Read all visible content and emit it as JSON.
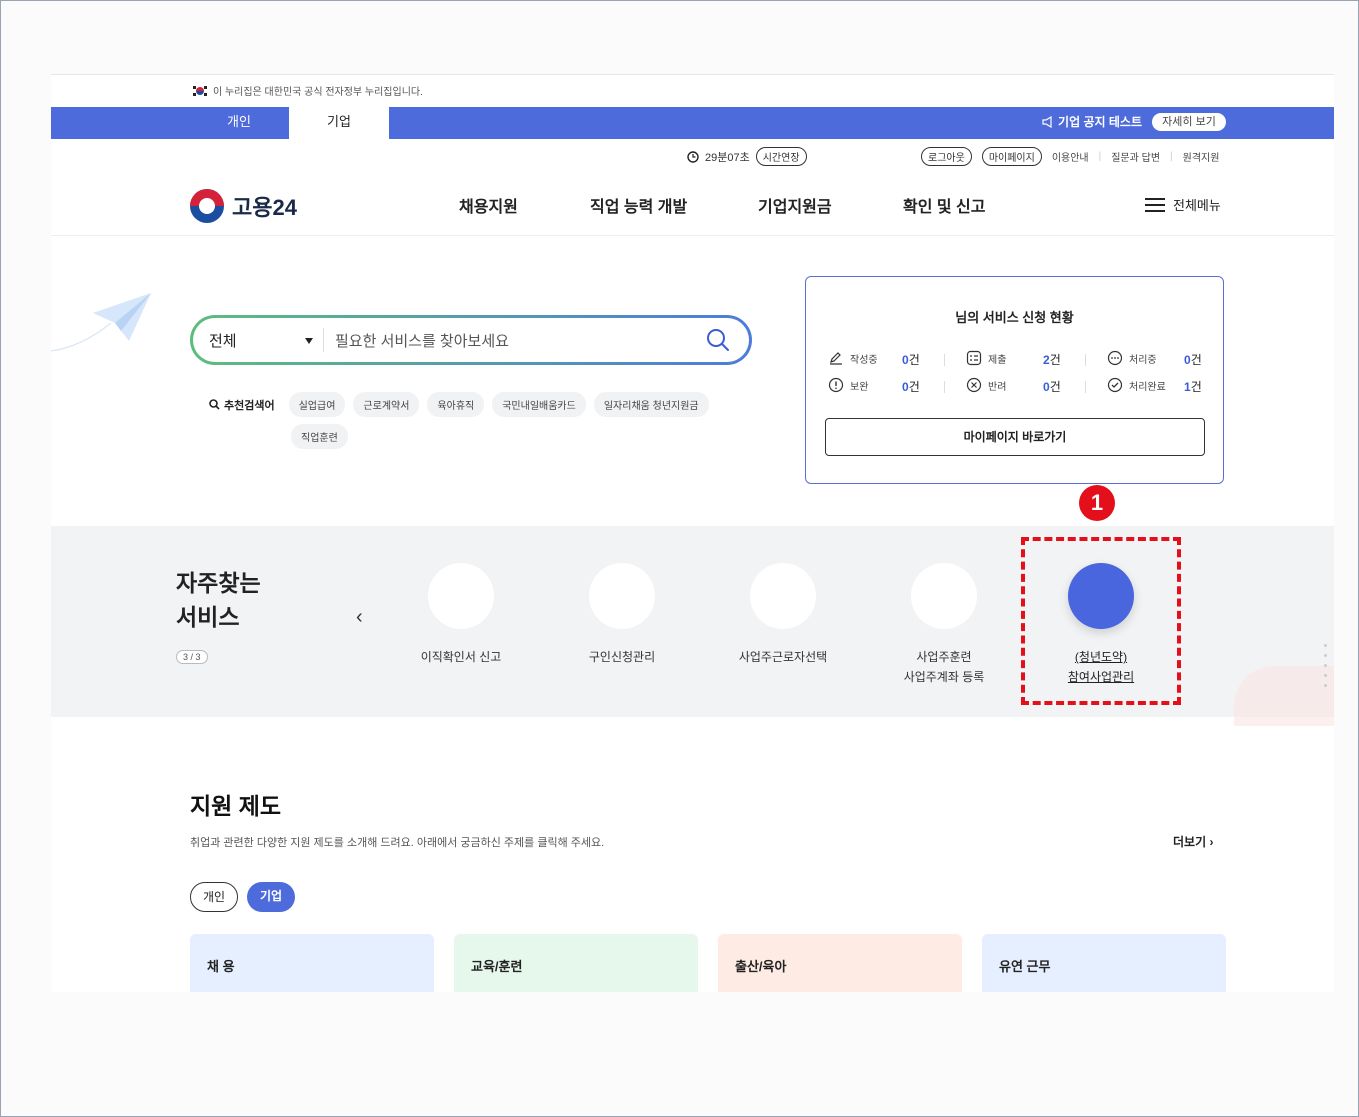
{
  "gov_banner": "이 누리집은 대한민국 공식 전자정부 누리집입니다.",
  "tabs": {
    "personal": "개인",
    "company": "기업"
  },
  "notice": {
    "text": "기업 공지 테스트",
    "button": "자세히 보기"
  },
  "session": {
    "timer": "29분07초",
    "extend": "시간연장"
  },
  "utility": {
    "logout": "로그아웃",
    "mypage": "마이페이지",
    "guide": "이용안내",
    "qa": "질문과 답변",
    "remote": "원격지원"
  },
  "logo": "고용24",
  "nav": [
    "채용지원",
    "직업 능력 개발",
    "기업지원금",
    "확인 및 신고"
  ],
  "all_menu": "전체메뉴",
  "search": {
    "category": "전체",
    "placeholder": "필요한 서비스를 찾아보세요",
    "rec_label": "추천검색어",
    "keywords": [
      "실업급여",
      "근로계약서",
      "육아휴직",
      "국민내일배움카드",
      "일자리채움 청년지원금",
      "직업훈련"
    ]
  },
  "status": {
    "title": "님의 서비스 신청 현황",
    "items": [
      {
        "label": "작성중",
        "count": "0",
        "unit": "건"
      },
      {
        "label": "제출",
        "count": "2",
        "unit": "건"
      },
      {
        "label": "처리중",
        "count": "0",
        "unit": "건"
      },
      {
        "label": "보완",
        "count": "0",
        "unit": "건"
      },
      {
        "label": "반려",
        "count": "0",
        "unit": "건"
      },
      {
        "label": "처리완료",
        "count": "1",
        "unit": "건"
      }
    ],
    "mypage_button": "마이페이지 바로가기"
  },
  "callout": "1",
  "frequent": {
    "title_line1": "자주찾는",
    "title_line2": "서비스",
    "page": "3 / 3",
    "services": [
      {
        "line1": "이직확인서 신고",
        "line2": ""
      },
      {
        "line1": "구인신청관리",
        "line2": ""
      },
      {
        "line1": "사업주근로자선택",
        "line2": ""
      },
      {
        "line1": "사업주훈련",
        "line2": "사업주계좌 등록"
      },
      {
        "line1": "(청년도약)",
        "line2": "참여사업관리"
      }
    ]
  },
  "support": {
    "title": "지원 제도",
    "desc": "취업과 관련한 다양한 지원 제도를 소개해 드려요. 아래에서 궁금하신 주제를 클릭해 주세요.",
    "more": "더보기",
    "toggle_personal": "개인",
    "toggle_company": "기업",
    "cards": [
      {
        "label": "채 용",
        "color": "#e6efff"
      },
      {
        "label": "교육/훈련",
        "color": "#e6f8ec"
      },
      {
        "label": "출산/육아",
        "color": "#fdebe4"
      },
      {
        "label": "유연 근무",
        "color": "#e6efff"
      }
    ]
  },
  "colors": {
    "brand_blue": "#4d6bdb",
    "highlight_red": "#e3101b"
  }
}
